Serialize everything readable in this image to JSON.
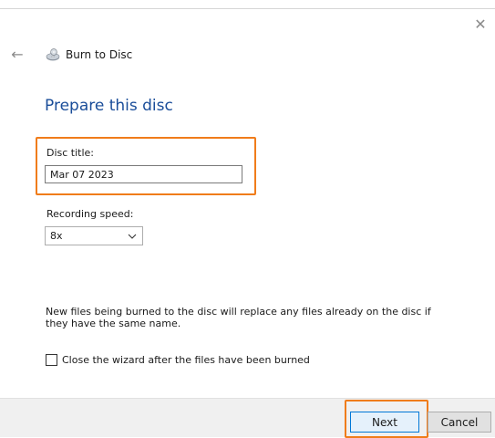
{
  "window": {
    "title": "Burn to Disc",
    "close_glyph": "✕",
    "back_glyph": "←",
    "icon": "disc-burn-icon"
  },
  "page": {
    "title": "Prepare this disc"
  },
  "form": {
    "disc_title_label": "Disc title:",
    "disc_title_value": "Mar 07 2023",
    "recording_speed_label": "Recording speed:",
    "recording_speed_value": "8x"
  },
  "info": {
    "text": "New files being burned to the disc will replace any files already on the disc if they have the same name."
  },
  "options": {
    "close_wizard_label": "Close the wizard after the files have been burned",
    "close_wizard_checked": false
  },
  "buttons": {
    "next_label": "Next",
    "cancel_label": "Cancel"
  },
  "colors": {
    "accent_title": "#1a4d99",
    "highlight": "#f07c1a",
    "focus_border": "#0078d7"
  }
}
